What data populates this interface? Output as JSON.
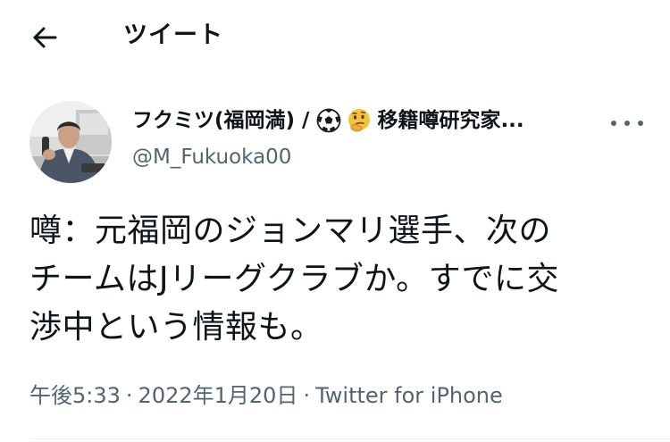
{
  "header": {
    "title": "ツイート",
    "back_icon": "back-arrow-icon"
  },
  "author": {
    "name_part1": "フクミツ(福岡満)",
    "name_slash": "/",
    "emoji1": "soccer-ball-icon",
    "emoji2": "thinking-face-icon",
    "name_part2": "移籍噂研究家...",
    "handle": "@M_Fukuoka00",
    "more_icon": "more-options-icon"
  },
  "tweet": {
    "text": "噂：元福岡のジョンマリ選手、次の\nチームはJリーグクラブか。すでに交\n渉中という情報も。",
    "time": "午後5:33",
    "date": "2022年1月20日",
    "separator": "·",
    "source": "Twitter for iPhone"
  },
  "colors": {
    "text_primary": "#0f1419",
    "text_secondary": "#536471",
    "divider": "#eff3f4"
  }
}
